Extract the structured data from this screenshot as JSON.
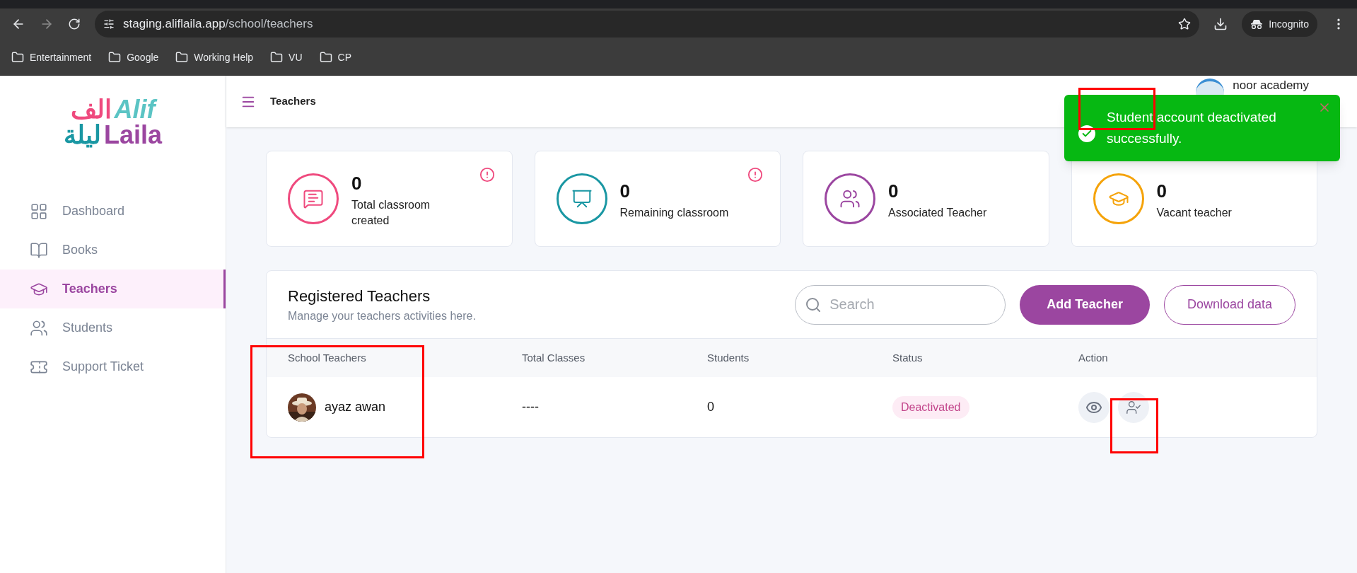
{
  "browser": {
    "url_host": "staging.aliflaila.app",
    "url_path": "/school/teachers",
    "profile": "Incognito",
    "bookmarks": [
      "Entertainment",
      "Google",
      "Working Help",
      "VU",
      "CP"
    ]
  },
  "logo": {
    "arabic_top": "الف",
    "latin_top": "Alif",
    "arabic_bottom": "ليلة",
    "latin_bottom": "Laila"
  },
  "sidebar": {
    "items": [
      {
        "label": "Dashboard",
        "selected": false
      },
      {
        "label": "Books",
        "selected": false
      },
      {
        "label": "Teachers",
        "selected": true
      },
      {
        "label": "Students",
        "selected": false
      },
      {
        "label": "Support Ticket",
        "selected": false
      }
    ]
  },
  "header": {
    "title": "Teachers",
    "user": "noor academy"
  },
  "toast": {
    "message": "Student account deactivated successfully."
  },
  "stats": [
    {
      "value": "0",
      "label": "Total classroom created",
      "color": "#ef4a7e",
      "alert": true
    },
    {
      "value": "0",
      "label": "Remaining classroom",
      "color": "#1a97a3",
      "alert": true
    },
    {
      "value": "0",
      "label": "Associated Teacher",
      "color": "#9b46a0",
      "alert": false
    },
    {
      "value": "0",
      "label": "Vacant teacher",
      "color": "#f5a30a",
      "alert": false
    }
  ],
  "panel": {
    "title": "Registered Teachers",
    "subtitle": "Manage your teachers activities here.",
    "search_placeholder": "Search",
    "buttons": [
      "Add Teacher",
      "Download data"
    ]
  },
  "table": {
    "columns": [
      "School Teachers",
      "Total Classes",
      "Students",
      "Status",
      "Action"
    ],
    "rows": [
      {
        "name": "ayaz awan",
        "classes": "----",
        "students": "0",
        "status": "Deactivated"
      }
    ]
  }
}
